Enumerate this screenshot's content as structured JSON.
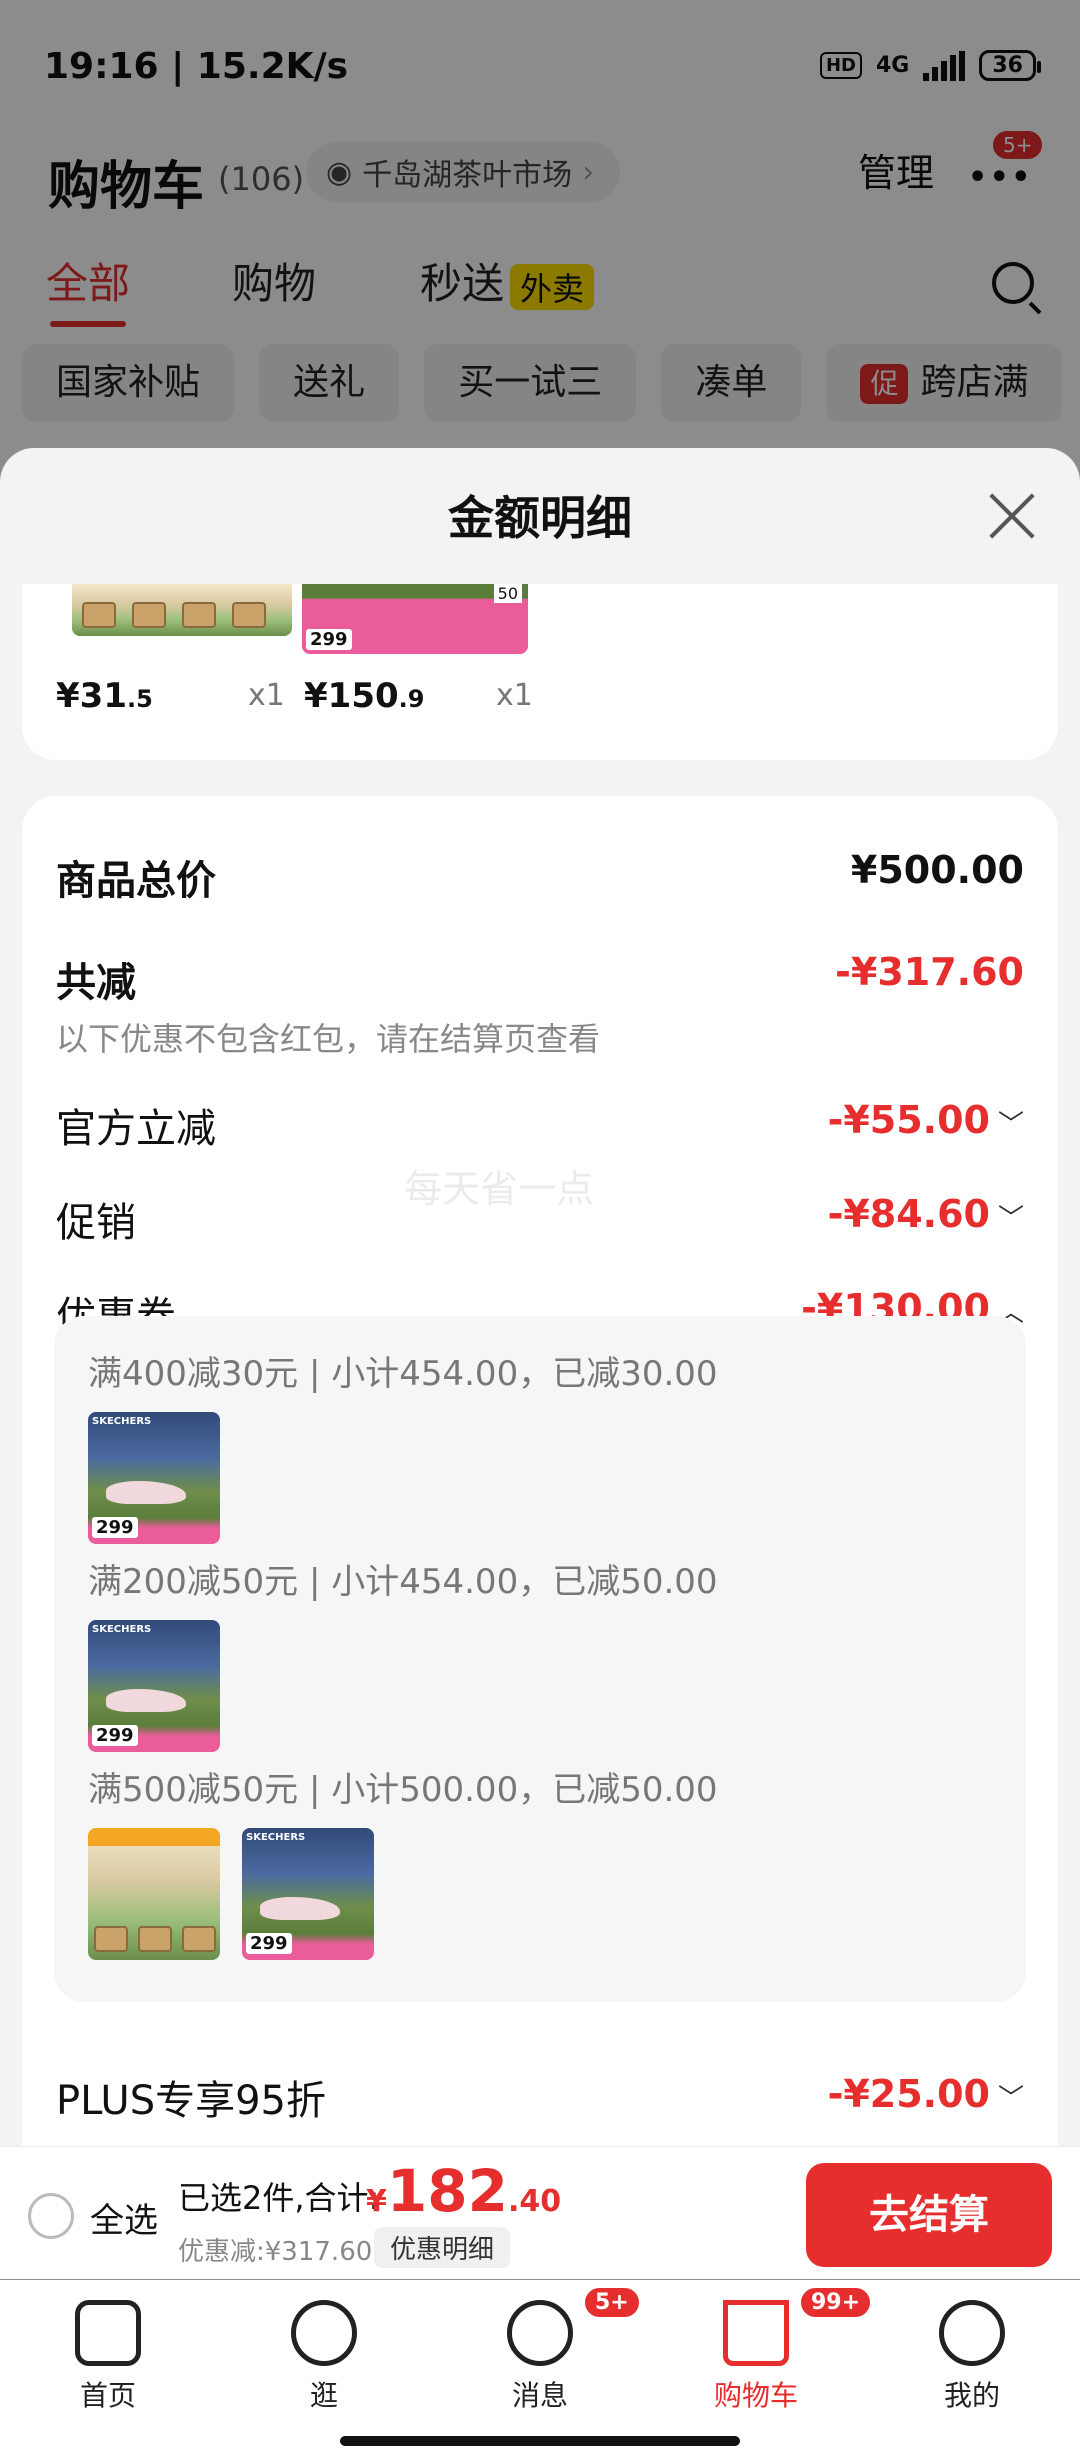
{
  "status_bar": {
    "time": "19:16 | 15.2K/s",
    "hd": "HD",
    "network": "4G",
    "battery": "36"
  },
  "header": {
    "title": "购物车",
    "count": "(106)",
    "location": "千岛湖茶叶市场",
    "manage": "管理",
    "more_badge": "5+"
  },
  "tabs": [
    {
      "label": "全部"
    },
    {
      "label": "购物"
    },
    {
      "label": "秒送"
    }
  ],
  "tab_badge": "外卖",
  "chips": {
    "c1": "国家补贴",
    "c2": "送礼",
    "c3": "买一试三",
    "c4": "凑单",
    "c5_icon": "促",
    "c5": "跨店满"
  },
  "modal": {
    "title": "金额明细",
    "items": [
      {
        "price_int": "¥31",
        "price_dec": ".5",
        "qty": "x1"
      },
      {
        "price_int": "¥150",
        "price_dec": ".9",
        "qty": "x1"
      }
    ],
    "thumb_price": "299",
    "thumb_tag": "50",
    "total_label": "商品总价",
    "total_value": "¥500.00",
    "reduce_label": "共减",
    "reduce_value": "-¥317.60",
    "reduce_note": "以下优惠不包含红包，请在结算页查看",
    "rows": [
      {
        "label": "官方立减",
        "value": "-¥55.00"
      },
      {
        "label": "促销",
        "value": "-¥84.60"
      },
      {
        "label": "优惠券",
        "value": "-¥130.00"
      }
    ],
    "coupons": [
      {
        "text": "满400减30元 | 小计454.00，已减30.00"
      },
      {
        "text": "满200减50元 | 小计454.00，已减50.00"
      },
      {
        "text": "满500减50元 | 小计500.00，已减50.00"
      }
    ],
    "plus_label": "PLUS专享95折",
    "plus_value": "-¥25.00",
    "watermark": "每天省一点"
  },
  "checkout": {
    "select_all": "全选",
    "selected": "已选2件,合计:",
    "currency": "¥",
    "total_int": "182",
    "total_dec": ".40",
    "discount": "优惠减:¥317.60",
    "detail": "优惠明细",
    "pay": "去结算"
  },
  "nav": [
    {
      "label": "首页"
    },
    {
      "label": "逛"
    },
    {
      "label": "消息",
      "badge": "5+"
    },
    {
      "label": "购物车",
      "badge": "99+"
    },
    {
      "label": "我的"
    }
  ],
  "colors": {
    "accent": "#e62e2e",
    "badge_yellow": "#ffdd00"
  }
}
